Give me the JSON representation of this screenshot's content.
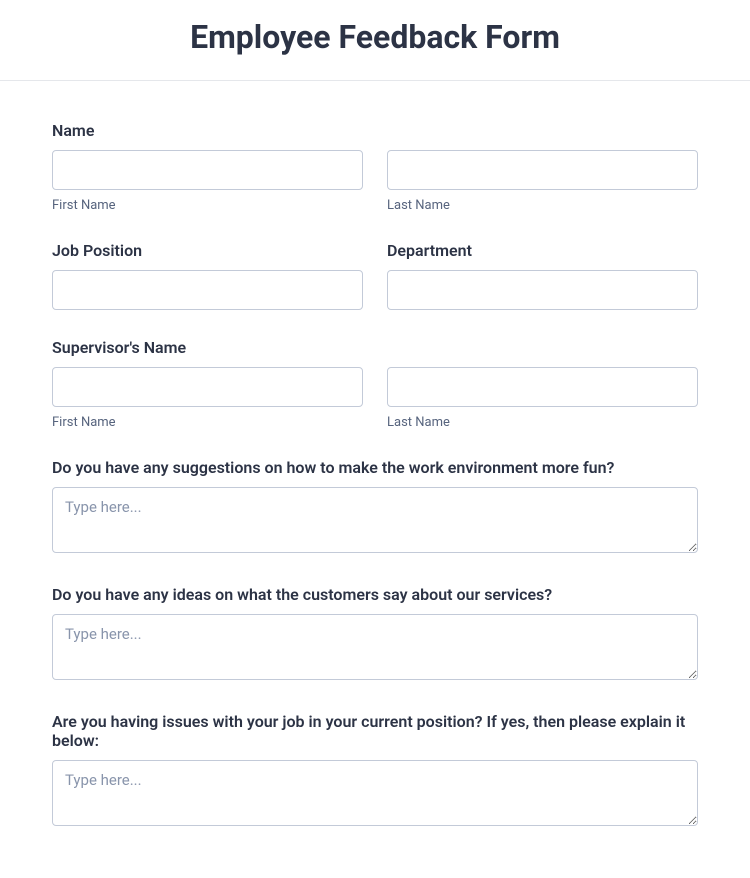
{
  "header": {
    "title": "Employee Feedback Form"
  },
  "name": {
    "label": "Name",
    "first_sublabel": "First Name",
    "last_sublabel": "Last Name",
    "first_value": "",
    "last_value": ""
  },
  "job": {
    "position_label": "Job Position",
    "position_value": "",
    "department_label": "Department",
    "department_value": ""
  },
  "supervisor": {
    "label": "Supervisor's Name",
    "first_sublabel": "First Name",
    "last_sublabel": "Last Name",
    "first_value": "",
    "last_value": ""
  },
  "q1": {
    "label": "Do you have any suggestions on how to make the work environment more fun?",
    "placeholder": "Type here...",
    "value": ""
  },
  "q2": {
    "label": "Do you have any ideas on what the customers say about our services?",
    "placeholder": "Type here...",
    "value": ""
  },
  "q3": {
    "label": "Are you having issues with your job in your current position? If yes, then please explain it below:",
    "placeholder": "Type here...",
    "value": ""
  }
}
